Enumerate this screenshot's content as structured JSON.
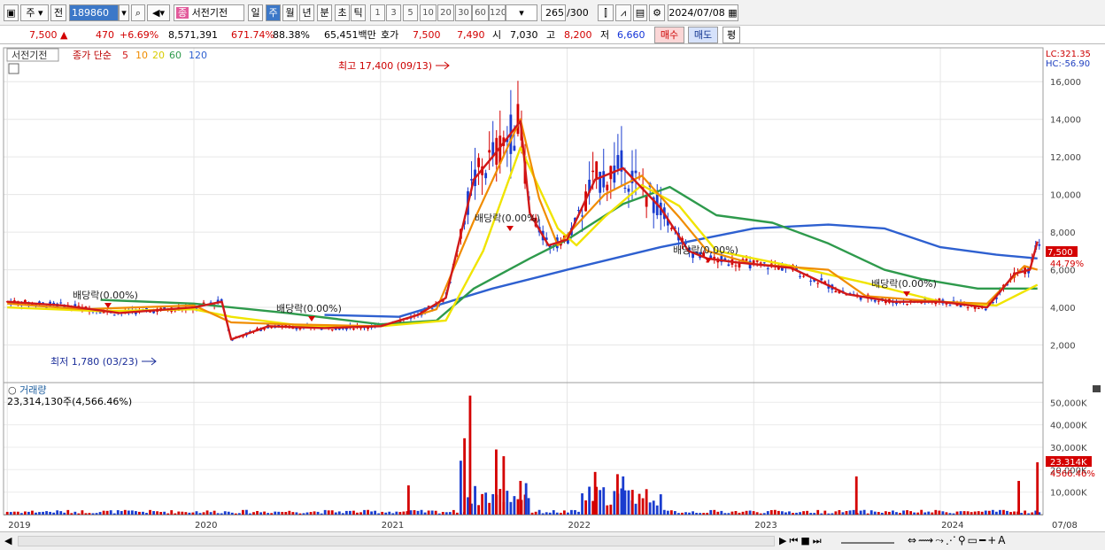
{
  "toolbar": {
    "period_select": "주",
    "mode_select": "전",
    "code": "189860",
    "name": "서전기전",
    "tabs": [
      "일",
      "주",
      "월",
      "년",
      "분",
      "초",
      "틱"
    ],
    "active_tab": "주",
    "periods": [
      "1",
      "3",
      "5",
      "10",
      "20",
      "30",
      "60",
      "120"
    ],
    "count": "265",
    "total": "/300",
    "date": "2024/07/08"
  },
  "quote": {
    "price": "7,500",
    "change": "470",
    "change_pct": "+6.69%",
    "volume": "8,571,391",
    "vol_ratio": "671.74%",
    "rate": "88.38%",
    "amount": "65,451백만",
    "bid_label": "호가",
    "bid1": "7,500",
    "bid2": "7,490",
    "open_label": "시",
    "open": "7,030",
    "high_label": "고",
    "high": "8,200",
    "low_label": "저",
    "low": "6,660",
    "buy": "매수",
    "sell": "매도",
    "flat": "평"
  },
  "legend": {
    "stock": "서전기전",
    "ma_label": "종가 단순",
    "ma": [
      {
        "p": "5",
        "color": "#d11919"
      },
      {
        "p": "10",
        "color": "#f08c00"
      },
      {
        "p": "20",
        "color": "#f0e400"
      },
      {
        "p": "60",
        "color": "#2e9a4c"
      },
      {
        "p": "120",
        "color": "#2e60d0"
      }
    ]
  },
  "right_info": {
    "lc": "LC:321.35",
    "hc": "HC:-56.90",
    "price_box": "7,500",
    "price_pct": "44.79%",
    "vol_box": "23.314K",
    "vol_pct": "4566.46%"
  },
  "annotations": {
    "high": "최고 17,400 (09/13)",
    "low": "최저 1,780 (03/23)",
    "dividend": "배당락(0.00%)"
  },
  "volume_panel": {
    "title": "거래량",
    "value": "23,314,130주(4,566.46%)"
  },
  "axis_x": [
    "2019",
    "2020",
    "2021",
    "2022",
    "2023",
    "2024",
    "07/08"
  ],
  "axis_price": [
    "16,000",
    "14,000",
    "12,000",
    "10,000",
    "8,000",
    "6,000",
    "4,000",
    "2,000"
  ],
  "axis_vol": [
    "50,000K",
    "40,000K",
    "30,000K",
    "20,000K",
    "10,000K"
  ],
  "chart_data": {
    "type": "candlestick",
    "price_ylim": [
      0,
      17800
    ],
    "volume_ylim": [
      0,
      58000
    ],
    "ma": {
      "ma5": [
        [
          2019.0,
          4300
        ],
        [
          2019.3,
          4100
        ],
        [
          2019.6,
          3700
        ],
        [
          2020.0,
          4000
        ],
        [
          2020.15,
          4300
        ],
        [
          2020.2,
          2300
        ],
        [
          2020.4,
          3000
        ],
        [
          2020.7,
          2900
        ],
        [
          2021.0,
          3000
        ],
        [
          2021.2,
          3600
        ],
        [
          2021.35,
          4500
        ],
        [
          2021.5,
          10800
        ],
        [
          2021.6,
          12000
        ],
        [
          2021.75,
          13900
        ],
        [
          2021.8,
          9000
        ],
        [
          2021.9,
          7300
        ],
        [
          2022.0,
          7600
        ],
        [
          2022.15,
          10800
        ],
        [
          2022.3,
          11400
        ],
        [
          2022.5,
          9300
        ],
        [
          2022.65,
          7000
        ],
        [
          2022.75,
          6600
        ],
        [
          2022.9,
          6400
        ],
        [
          2023.2,
          6100
        ],
        [
          2023.5,
          4700
        ],
        [
          2023.75,
          4300
        ],
        [
          2024.0,
          4300
        ],
        [
          2024.25,
          4000
        ],
        [
          2024.4,
          5800
        ],
        [
          2024.48,
          6000
        ],
        [
          2024.52,
          7500
        ]
      ],
      "ma10": [
        [
          2019.0,
          4200
        ],
        [
          2019.4,
          3900
        ],
        [
          2020.0,
          4100
        ],
        [
          2020.2,
          3200
        ],
        [
          2020.5,
          3100
        ],
        [
          2021.0,
          3000
        ],
        [
          2021.3,
          3900
        ],
        [
          2021.5,
          8600
        ],
        [
          2021.75,
          14000
        ],
        [
          2021.85,
          9800
        ],
        [
          2021.95,
          7300
        ],
        [
          2022.2,
          10000
        ],
        [
          2022.4,
          11000
        ],
        [
          2022.6,
          8800
        ],
        [
          2022.75,
          7000
        ],
        [
          2023.0,
          6300
        ],
        [
          2023.4,
          6000
        ],
        [
          2023.6,
          4600
        ],
        [
          2024.0,
          4300
        ],
        [
          2024.25,
          4200
        ],
        [
          2024.45,
          6200
        ],
        [
          2024.52,
          6000
        ]
      ],
      "ma20": [
        [
          2019.0,
          4000
        ],
        [
          2019.5,
          3800
        ],
        [
          2020.0,
          3900
        ],
        [
          2020.2,
          3500
        ],
        [
          2020.6,
          3000
        ],
        [
          2021.0,
          3000
        ],
        [
          2021.35,
          3300
        ],
        [
          2021.55,
          7000
        ],
        [
          2021.75,
          12500
        ],
        [
          2021.95,
          8200
        ],
        [
          2022.05,
          7300
        ],
        [
          2022.2,
          8800
        ],
        [
          2022.4,
          10500
        ],
        [
          2022.6,
          9400
        ],
        [
          2022.8,
          7000
        ],
        [
          2023.2,
          6200
        ],
        [
          2023.6,
          5300
        ],
        [
          2024.0,
          4300
        ],
        [
          2024.3,
          4100
        ],
        [
          2024.52,
          5200
        ]
      ],
      "ma60": [
        [
          2019.5,
          4400
        ],
        [
          2020.0,
          4200
        ],
        [
          2020.5,
          3700
        ],
        [
          2021.0,
          3100
        ],
        [
          2021.3,
          3300
        ],
        [
          2021.5,
          5000
        ],
        [
          2021.8,
          6600
        ],
        [
          2022.0,
          7600
        ],
        [
          2022.3,
          9500
        ],
        [
          2022.55,
          10400
        ],
        [
          2022.8,
          8900
        ],
        [
          2023.1,
          8500
        ],
        [
          2023.4,
          7400
        ],
        [
          2023.7,
          6000
        ],
        [
          2023.9,
          5500
        ],
        [
          2024.2,
          5000
        ],
        [
          2024.52,
          5000
        ]
      ],
      "ma120": [
        [
          2020.7,
          3600
        ],
        [
          2021.1,
          3500
        ],
        [
          2021.6,
          5000
        ],
        [
          2022.0,
          6000
        ],
        [
          2022.5,
          7200
        ],
        [
          2023.0,
          8200
        ],
        [
          2023.4,
          8400
        ],
        [
          2023.7,
          8200
        ],
        [
          2024.0,
          7200
        ],
        [
          2024.3,
          6800
        ],
        [
          2024.52,
          6600
        ]
      ]
    },
    "dividend_markers": [
      2019.5,
      2020.5,
      2021.3,
      2021.85,
      2022.9,
      2023.8
    ]
  }
}
